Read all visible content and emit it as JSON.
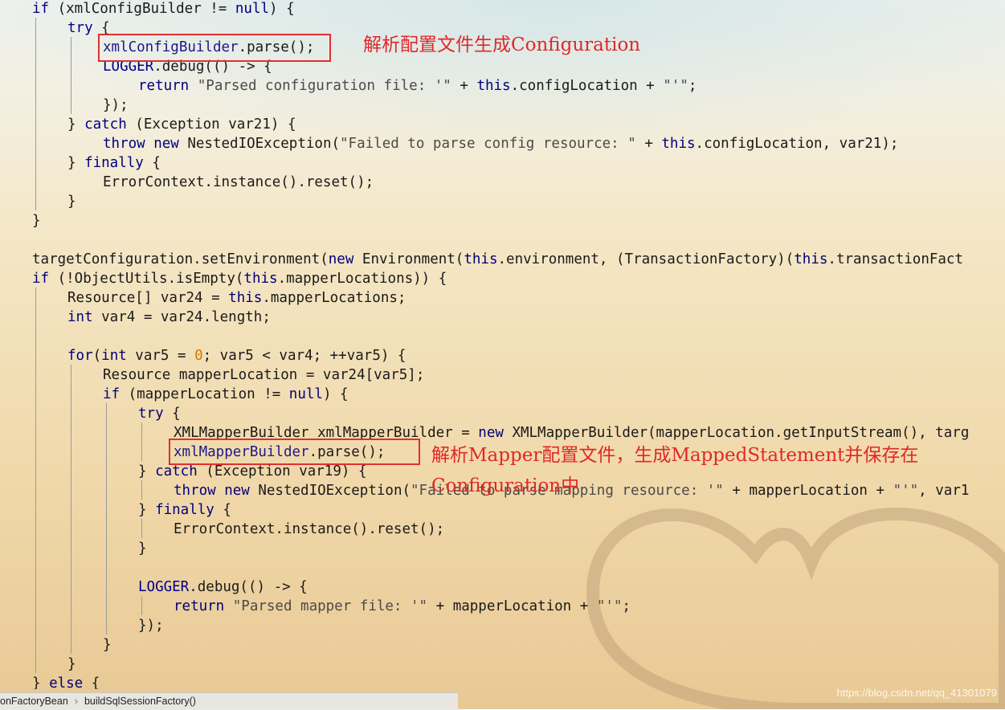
{
  "editor": {
    "code_lines": [
      {
        "indent": 1,
        "tokens": [
          [
            "kw",
            "if"
          ],
          [
            "p",
            " (xmlConfigBuilder != "
          ],
          [
            "kw",
            "null"
          ],
          [
            "p",
            ") {"
          ]
        ]
      },
      {
        "indent": 2,
        "tokens": [
          [
            "kw",
            "try"
          ],
          [
            "p",
            " {"
          ]
        ]
      },
      {
        "indent": 3,
        "tokens": [
          [
            "id",
            "xmlConfigBuilder"
          ],
          [
            "p",
            ".parse();"
          ]
        ]
      },
      {
        "indent": 3,
        "tokens": [
          [
            "fld",
            "LOGGER"
          ],
          [
            "p",
            ".debug(() -> {"
          ]
        ]
      },
      {
        "indent": 4,
        "tokens": [
          [
            "kw",
            "return"
          ],
          [
            "str",
            " \"Parsed configuration file: '\""
          ],
          [
            "p",
            " + "
          ],
          [
            "kw",
            "this"
          ],
          [
            "p",
            ".configLocation + "
          ],
          [
            "str",
            "\"'\""
          ],
          [
            "p",
            ";"
          ]
        ]
      },
      {
        "indent": 3,
        "tokens": [
          [
            "p",
            "});"
          ]
        ]
      },
      {
        "indent": 2,
        "tokens": [
          [
            "p",
            "} "
          ],
          [
            "kw",
            "catch"
          ],
          [
            "p",
            " (Exception var21) {"
          ]
        ]
      },
      {
        "indent": 3,
        "tokens": [
          [
            "kw",
            "throw new"
          ],
          [
            "p",
            " NestedIOException("
          ],
          [
            "str",
            "\"Failed to parse config resource: \""
          ],
          [
            "p",
            " + "
          ],
          [
            "kw",
            "this"
          ],
          [
            "p",
            ".configLocation, var21);"
          ]
        ]
      },
      {
        "indent": 2,
        "tokens": [
          [
            "p",
            "} "
          ],
          [
            "kw",
            "finally"
          ],
          [
            "p",
            " {"
          ]
        ]
      },
      {
        "indent": 3,
        "tokens": [
          [
            "p",
            "ErrorContext.instance().reset();"
          ]
        ]
      },
      {
        "indent": 2,
        "tokens": [
          [
            "p",
            "}"
          ]
        ]
      },
      {
        "indent": 1,
        "tokens": [
          [
            "p",
            "}"
          ]
        ]
      },
      {
        "indent": 1,
        "tokens": []
      },
      {
        "indent": 1,
        "tokens": [
          [
            "p",
            "targetConfiguration.setEnvironment("
          ],
          [
            "kw",
            "new"
          ],
          [
            "p",
            " Environment("
          ],
          [
            "kw",
            "this"
          ],
          [
            "p",
            ".environment, (TransactionFactory)("
          ],
          [
            "kw",
            "this"
          ],
          [
            "p",
            ".transactionFact"
          ]
        ]
      },
      {
        "indent": 1,
        "tokens": [
          [
            "kw",
            "if"
          ],
          [
            "p",
            " (!ObjectUtils.isEmpty("
          ],
          [
            "kw",
            "this"
          ],
          [
            "p",
            ".mapperLocations)) {"
          ]
        ]
      },
      {
        "indent": 2,
        "tokens": [
          [
            "p",
            "Resource[] var24 = "
          ],
          [
            "kw",
            "this"
          ],
          [
            "p",
            ".mapperLocations;"
          ]
        ]
      },
      {
        "indent": 2,
        "tokens": [
          [
            "kw",
            "int"
          ],
          [
            "p",
            " var4 = var24.length;"
          ]
        ]
      },
      {
        "indent": 2,
        "tokens": []
      },
      {
        "indent": 2,
        "tokens": [
          [
            "kw",
            "for"
          ],
          [
            "p",
            "("
          ],
          [
            "kw",
            "int"
          ],
          [
            "p",
            " var5 = "
          ],
          [
            "num",
            "0"
          ],
          [
            "p",
            "; var5 < var4; ++var5) {"
          ]
        ]
      },
      {
        "indent": 3,
        "tokens": [
          [
            "p",
            "Resource mapperLocation = var24[var5];"
          ]
        ]
      },
      {
        "indent": 3,
        "tokens": [
          [
            "kw",
            "if"
          ],
          [
            "p",
            " (mapperLocation != "
          ],
          [
            "kw",
            "null"
          ],
          [
            "p",
            ") {"
          ]
        ]
      },
      {
        "indent": 4,
        "tokens": [
          [
            "kw",
            "try"
          ],
          [
            "p",
            " {"
          ]
        ]
      },
      {
        "indent": 5,
        "tokens": [
          [
            "p",
            "XMLMapperBuilder xmlMapperBuilder = "
          ],
          [
            "kw",
            "new"
          ],
          [
            "p",
            " XMLMapperBuilder(mapperLocation.getInputStream(), targ"
          ]
        ]
      },
      {
        "indent": 5,
        "tokens": [
          [
            "id",
            "xmlMapperBuilder"
          ],
          [
            "p",
            ".parse();"
          ]
        ]
      },
      {
        "indent": 4,
        "tokens": [
          [
            "p",
            "} "
          ],
          [
            "kw",
            "catch"
          ],
          [
            "p",
            " (Exception var19) {"
          ]
        ]
      },
      {
        "indent": 5,
        "tokens": [
          [
            "kw",
            "throw new"
          ],
          [
            "p",
            " NestedIOException("
          ],
          [
            "str",
            "\"Failed to parse mapping resource: '\""
          ],
          [
            "p",
            " + mapperLocation + "
          ],
          [
            "str",
            "\"'\""
          ],
          [
            "p",
            ", var1"
          ]
        ]
      },
      {
        "indent": 4,
        "tokens": [
          [
            "p",
            "} "
          ],
          [
            "kw",
            "finally"
          ],
          [
            "p",
            " {"
          ]
        ]
      },
      {
        "indent": 5,
        "tokens": [
          [
            "p",
            "ErrorContext.instance().reset();"
          ]
        ]
      },
      {
        "indent": 4,
        "tokens": [
          [
            "p",
            "}"
          ]
        ]
      },
      {
        "indent": 4,
        "tokens": []
      },
      {
        "indent": 4,
        "tokens": [
          [
            "fld",
            "LOGGER"
          ],
          [
            "p",
            ".debug(() -> {"
          ]
        ]
      },
      {
        "indent": 5,
        "tokens": [
          [
            "kw",
            "return"
          ],
          [
            "str",
            " \"Parsed mapper file: '\""
          ],
          [
            "p",
            " + mapperLocation + "
          ],
          [
            "str",
            "\"'\""
          ],
          [
            "p",
            ";"
          ]
        ]
      },
      {
        "indent": 4,
        "tokens": [
          [
            "p",
            "});"
          ]
        ]
      },
      {
        "indent": 3,
        "tokens": [
          [
            "p",
            "}"
          ]
        ]
      },
      {
        "indent": 2,
        "tokens": [
          [
            "p",
            "}"
          ]
        ]
      },
      {
        "indent": 1,
        "tokens": [
          [
            "p",
            "} "
          ],
          [
            "kw",
            "else"
          ],
          [
            "p",
            " {"
          ]
        ]
      }
    ]
  },
  "annotations": {
    "config_note": "解析配置文件生成Configuration",
    "mapper_note_line1": "解析Mapper配置文件，生成MappedStatement并保存在",
    "mapper_note_line2": "Configuration中"
  },
  "breadcrumb": {
    "item1": "onFactoryBean",
    "separator": "›",
    "item2": "buildSqlSessionFactory()"
  },
  "watermark": "https://blog.csdn.net/qq_41301079",
  "colors": {
    "keyword": "#00007a",
    "annotation_red": "#e02828",
    "highlight_box": "#e03030"
  }
}
